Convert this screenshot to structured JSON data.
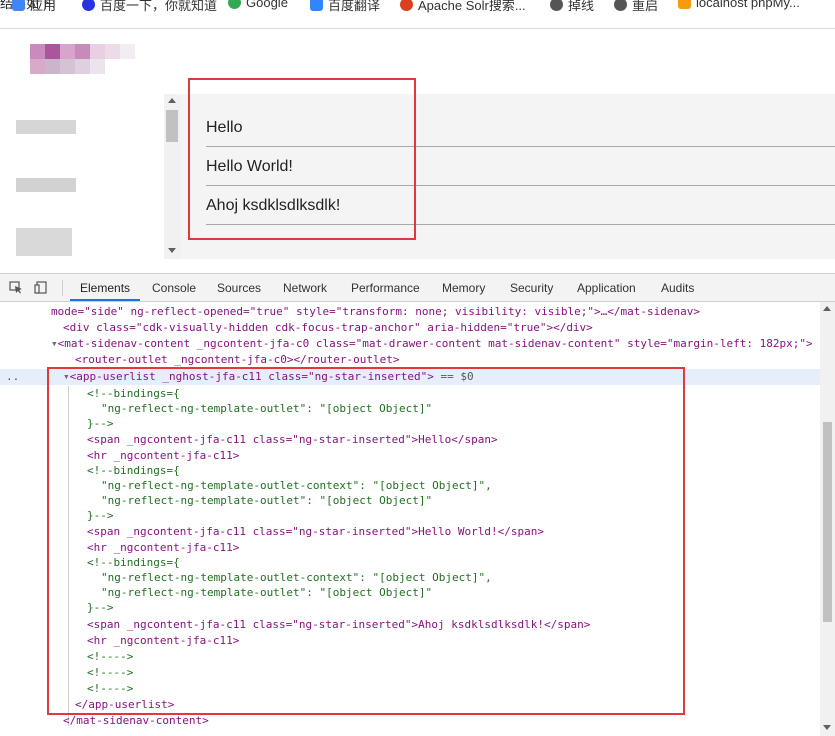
{
  "bookmarks_bar": {
    "top_text": "结果如下:",
    "items": [
      {
        "label": "应用",
        "icon": "apps-icon",
        "color": "#4285f4"
      },
      {
        "label": "百度一下，你就知道",
        "icon": "baidu-icon",
        "color": "#2932e1"
      },
      {
        "label": "Google",
        "icon": "google-icon",
        "color": "#34a853"
      },
      {
        "label": "百度翻译",
        "icon": "baidu-translate-icon",
        "color": "#3385ff"
      },
      {
        "label": "Apache Solr搜索...",
        "icon": "solr-icon",
        "color": "#d9411e"
      },
      {
        "label": "掉线",
        "icon": "globe-icon",
        "color": "#555555"
      },
      {
        "label": "重启",
        "icon": "globe-icon",
        "color": "#555555"
      },
      {
        "label": "localhost phpMy...",
        "icon": "phpmyadmin-icon",
        "color": "#f89c0e"
      }
    ]
  },
  "app_view": {
    "list_items": [
      "Hello",
      "Hello World!",
      "Ahoj ksdklsdlksdlk!"
    ]
  },
  "devtools": {
    "tabs": [
      "Elements",
      "Console",
      "Sources",
      "Network",
      "Performance",
      "Memory",
      "Security",
      "Application",
      "Audits"
    ],
    "active_tab": "Elements",
    "accent_color": "#1a73e8",
    "highlight_color": "#e0393b",
    "selected_suffix": "== $0",
    "row_marker": "..",
    "lines": {
      "l1_pre": "mode=\"side\" ng-reflect-opened=\"true\" style=\"transform: none; visibility: visible;\">…</mat-sidenav>",
      "l2": "<div class=\"cdk-visually-hidden cdk-focus-trap-anchor\" aria-hidden=\"true\"></div>",
      "l3": "<mat-sidenav-content _ngcontent-jfa-c0 class=\"mat-drawer-content mat-sidenav-content\" style=\"margin-left: 182px;\">",
      "l4": "<router-outlet _ngcontent-jfa-c0></router-outlet>",
      "l5": "<app-userlist _nghost-jfa-c11 class=\"ng-star-inserted\">",
      "c_open": "<!--bindings={",
      "c_tpl": "\"ng-reflect-ng-template-outlet\": \"[object Object]\"",
      "c_ctx": "\"ng-reflect-ng-template-outlet-context\": \"[object Object]\",",
      "c_close": "}-->",
      "span1": "<span _ngcontent-jfa-c11 class=\"ng-star-inserted\">Hello</span>",
      "hr": "<hr _ngcontent-jfa-c11>",
      "span2": "<span _ngcontent-jfa-c11 class=\"ng-star-inserted\">Hello World!</span>",
      "span3": "<span _ngcontent-jfa-c11 class=\"ng-star-inserted\">Ahoj ksdklsdlksdlk!</span>",
      "empty_comment": "<!---->",
      "close_userlist": "</app-userlist>",
      "close_sidenav": "</mat-sidenav-content>"
    }
  }
}
